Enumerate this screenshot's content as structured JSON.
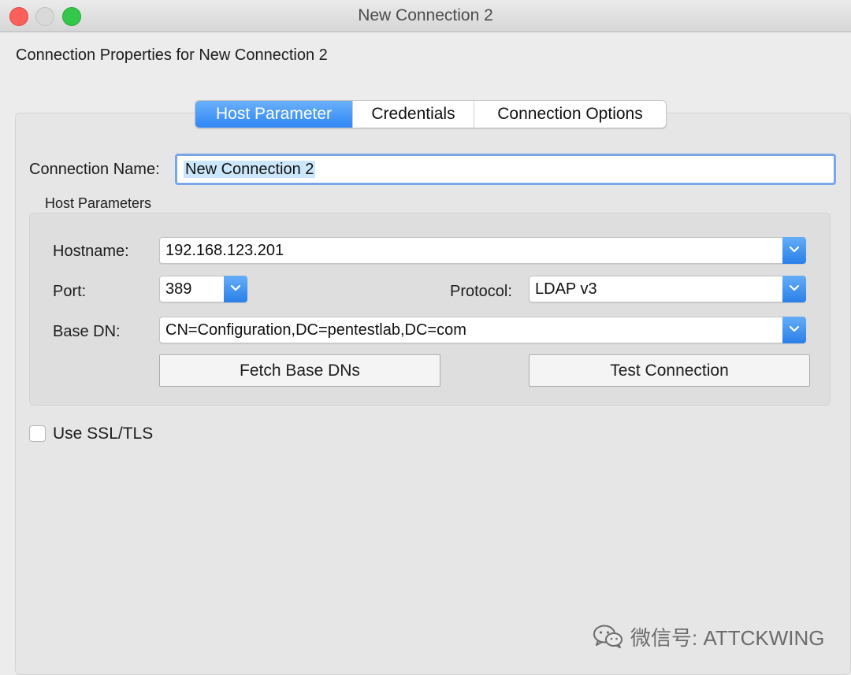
{
  "window": {
    "title": "New Connection 2"
  },
  "subtitle": "Connection Properties for New Connection 2",
  "tabs": [
    {
      "label": "Host Parameter",
      "active": true
    },
    {
      "label": "Credentials",
      "active": false
    },
    {
      "label": "Connection Options",
      "active": false
    }
  ],
  "connection_name": {
    "label": "Connection Name:",
    "value": "New Connection 2"
  },
  "host_parameters": {
    "group_label": "Host Parameters",
    "hostname": {
      "label": "Hostname:",
      "value": "192.168.123.201"
    },
    "port": {
      "label": "Port:",
      "value": "389"
    },
    "protocol": {
      "label": "Protocol:",
      "value": "LDAP v3"
    },
    "base_dn": {
      "label": "Base DN:",
      "value": "CN=Configuration,DC=pentestlab,DC=com"
    },
    "fetch_button": "Fetch Base DNs",
    "test_button": "Test Connection"
  },
  "ssl": {
    "label": "Use SSL/TLS",
    "checked": false
  },
  "watermark": {
    "text": "微信号: ATTCKWING",
    "icon": "wechat-icon"
  },
  "colors": {
    "accent": "#2f86f6",
    "focus_ring": "#7aa7e8",
    "selection": "#cce7fb"
  }
}
